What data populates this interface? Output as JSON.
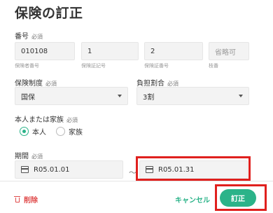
{
  "page": {
    "title": "保険の訂正"
  },
  "number": {
    "label": "番号",
    "required": "必須",
    "fields": [
      {
        "value": "010108",
        "caption": "保険者番号"
      },
      {
        "value": "1",
        "caption": "保険証記号"
      },
      {
        "value": "2",
        "caption": "保険証番号"
      },
      {
        "value": "省略可",
        "caption": "枝番"
      }
    ]
  },
  "system": {
    "label": "保険制度",
    "required": "必須",
    "value": "国保"
  },
  "ratio": {
    "label": "負担割合",
    "required": "必須",
    "value": "3割"
  },
  "relation": {
    "label": "本人または家族",
    "required": "必須",
    "options": [
      "本人",
      "家族"
    ],
    "selected": "本人"
  },
  "period": {
    "label": "期間",
    "required": "必須",
    "start": "R05.01.01",
    "separator": "〜",
    "end": "R05.01.31"
  },
  "footer": {
    "delete": "削除",
    "cancel": "キャンセル",
    "submit": "訂正"
  },
  "colors": {
    "accent": "#2bb389",
    "danger": "#e04b4b",
    "highlight": "#e0201e"
  }
}
